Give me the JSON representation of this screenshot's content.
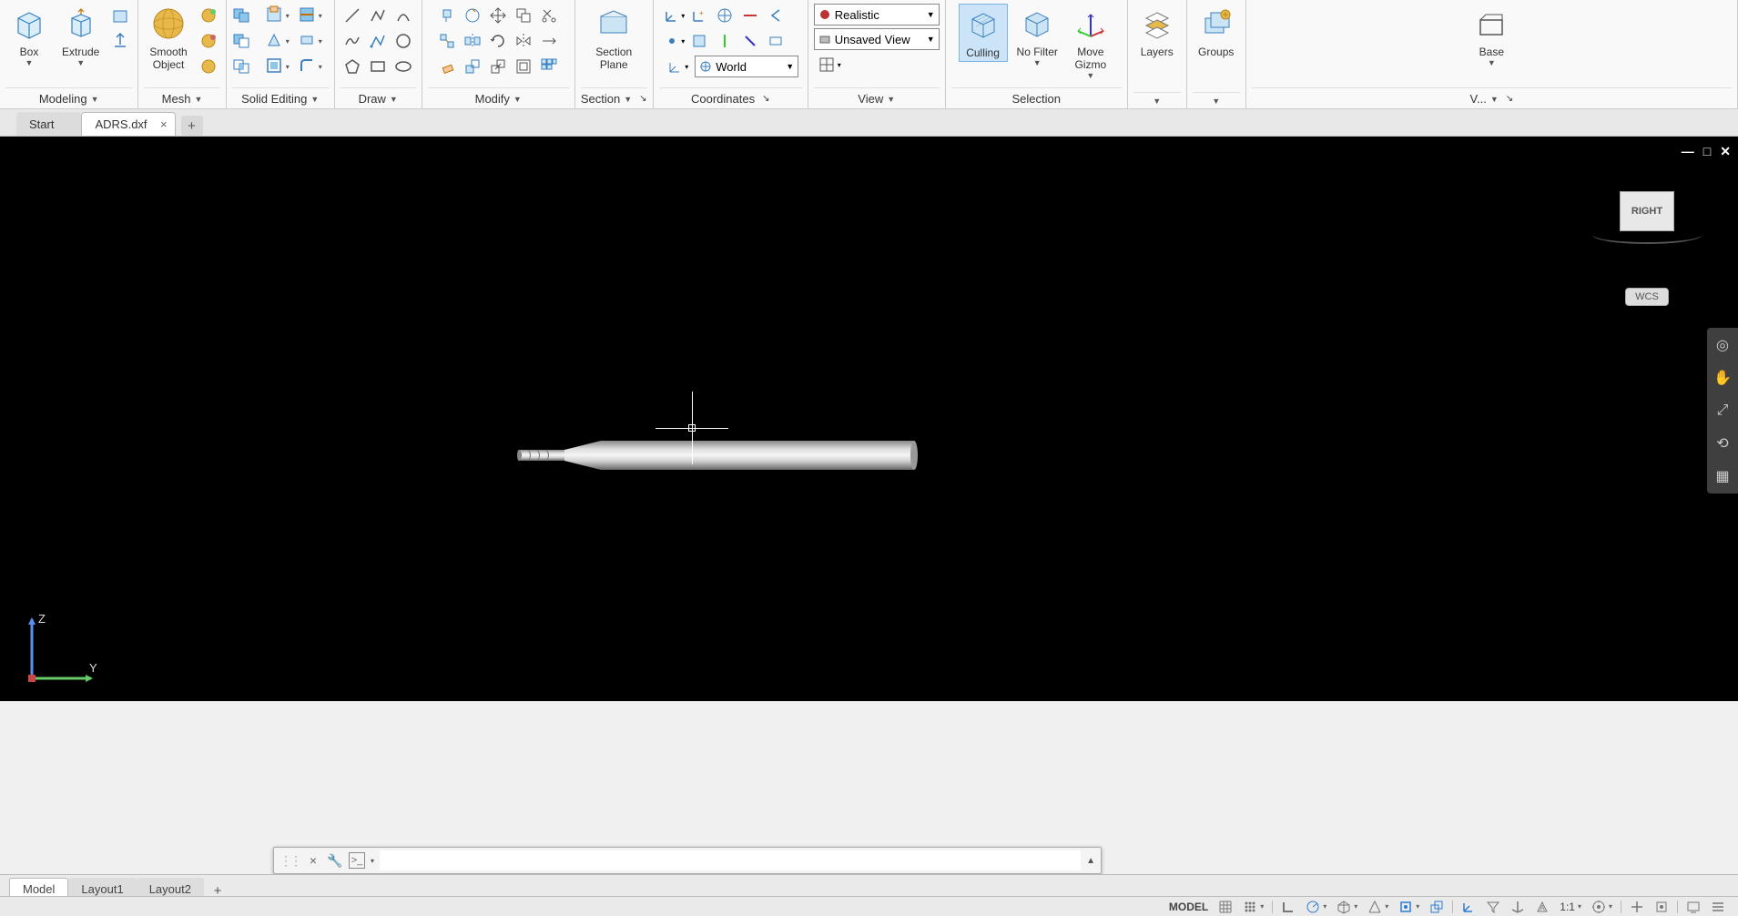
{
  "ribbon": {
    "modeling": {
      "label": "Modeling",
      "box": "Box",
      "extrude": "Extrude"
    },
    "mesh": {
      "label": "Mesh",
      "smooth_object": "Smooth\nObject"
    },
    "solid_editing": {
      "label": "Solid Editing"
    },
    "draw": {
      "label": "Draw"
    },
    "modify": {
      "label": "Modify"
    },
    "section": {
      "label": "Section",
      "section_plane": "Section\nPlane"
    },
    "coordinates": {
      "label": "Coordinates",
      "world": "World"
    },
    "view": {
      "label": "View",
      "realistic": "Realistic",
      "unsaved_view": "Unsaved View"
    },
    "selection": {
      "label": "Selection",
      "culling": "Culling",
      "no_filter": "No Filter",
      "move_gizmo": "Move\nGizmo"
    },
    "layers": {
      "label": "Layers"
    },
    "groups": {
      "label": "Groups"
    },
    "base": {
      "label": "Base",
      "panel_label": "V..."
    }
  },
  "file_tabs": {
    "start": "Start",
    "active": "ADRS.dxf"
  },
  "viewport": {
    "viewcube": "RIGHT",
    "wcs": "WCS",
    "ucs": {
      "z": "Z",
      "y": "Y"
    }
  },
  "layout_tabs": {
    "model": "Model",
    "layout1": "Layout1",
    "layout2": "Layout2"
  },
  "statusbar": {
    "model": "MODEL",
    "scale": "1:1"
  },
  "cmdline": {
    "value": ""
  }
}
